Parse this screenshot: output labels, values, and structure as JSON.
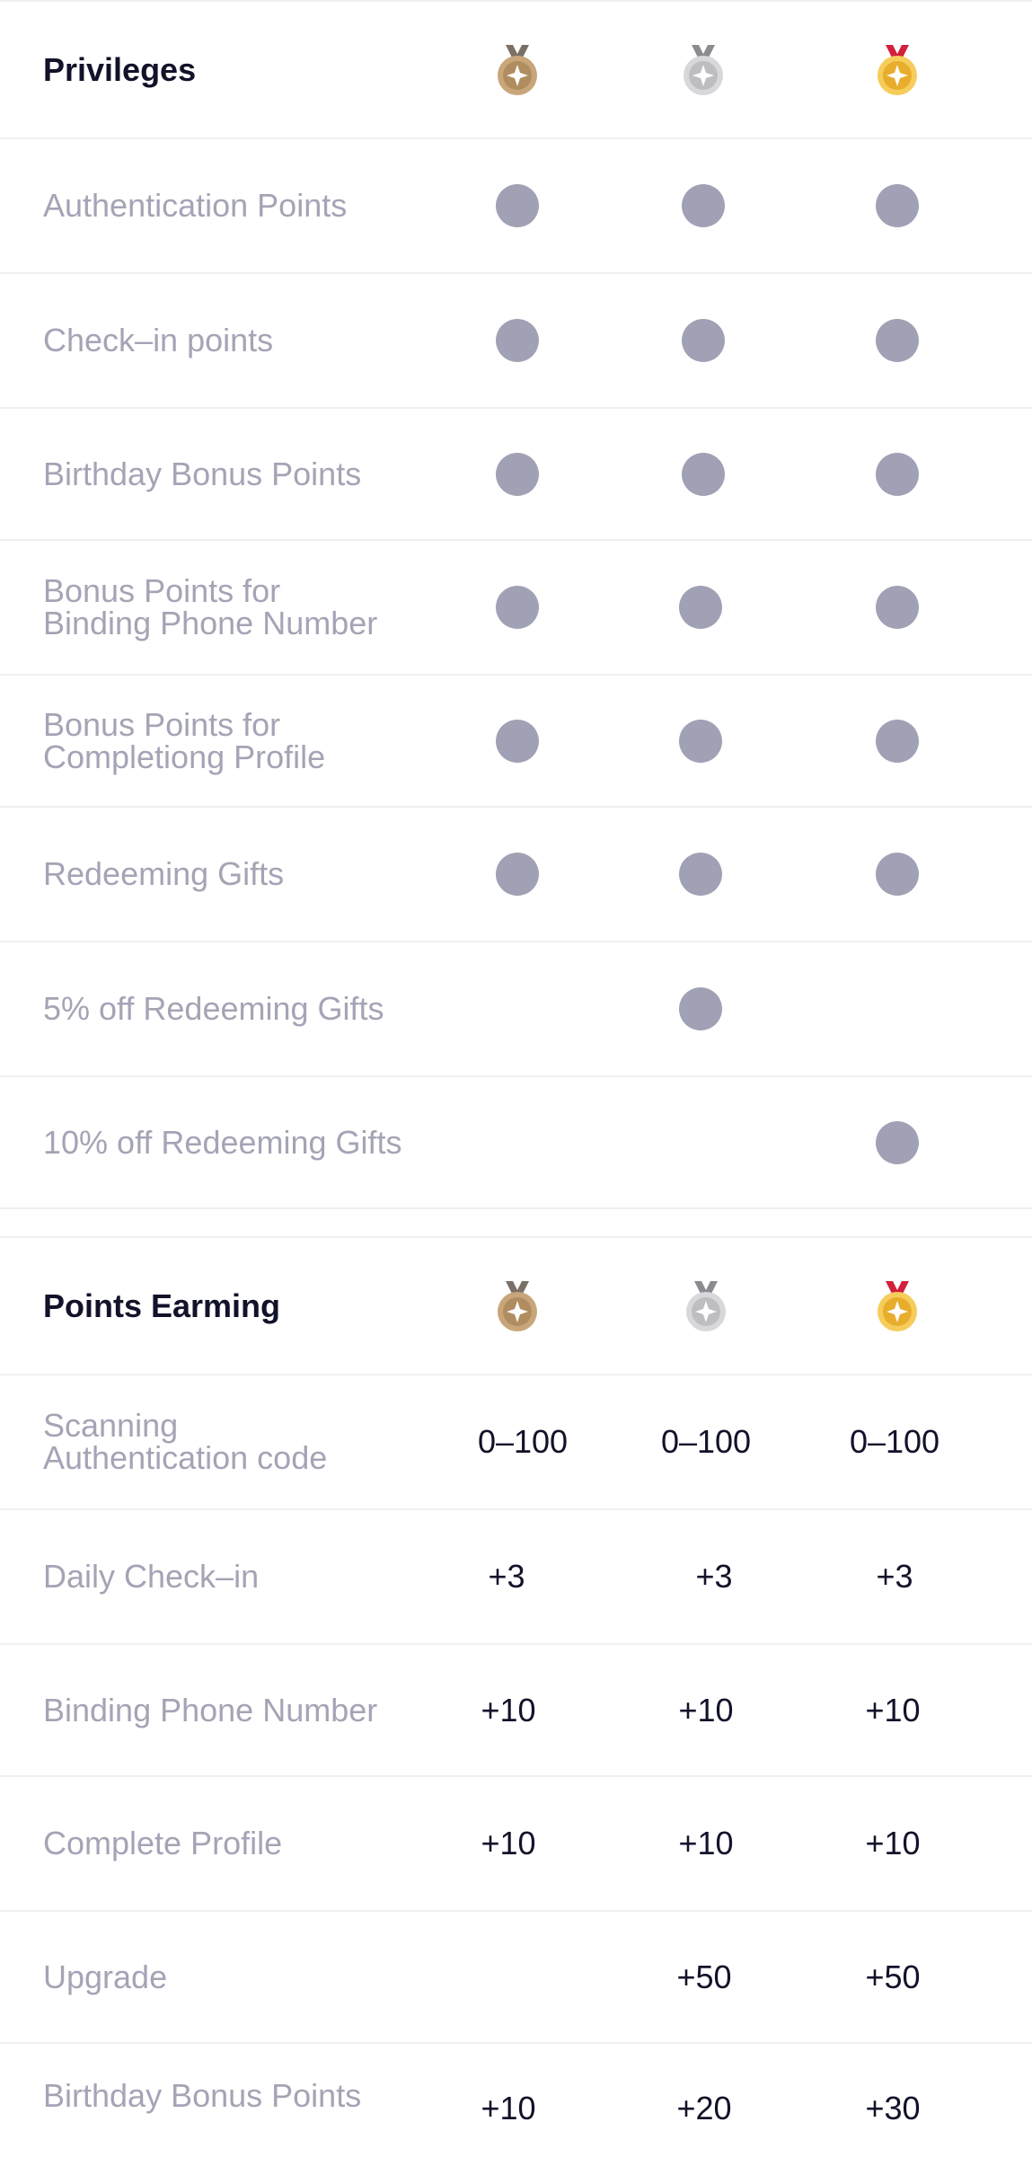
{
  "privileges": {
    "header": {
      "label": "Privileges",
      "tier_icons": [
        "bronze-medal-icon",
        "silver-medal-icon",
        "gold-medal-icon"
      ]
    },
    "rows": [
      {
        "label": "Authentication Points",
        "tiers": [
          true,
          true,
          true
        ]
      },
      {
        "label": "Check–in points",
        "tiers": [
          true,
          true,
          true
        ]
      },
      {
        "label": "Birthday Bonus Points",
        "tiers": [
          true,
          true,
          true
        ]
      },
      {
        "label": "Bonus Points for\nBinding Phone Number",
        "tiers": [
          true,
          true,
          true
        ]
      },
      {
        "label": "Bonus Points for\nCompletiong Profile",
        "tiers": [
          true,
          true,
          true
        ]
      },
      {
        "label": "Redeeming Gifts",
        "tiers": [
          true,
          true,
          true
        ]
      },
      {
        "label": "5% off Redeeming Gifts",
        "tiers": [
          false,
          true,
          false
        ]
      },
      {
        "label": "10% off Redeeming Gifts",
        "tiers": [
          false,
          false,
          true
        ]
      }
    ]
  },
  "points_earning": {
    "header": {
      "label": "Points Earming",
      "tier_icons": [
        "bronze-medal-icon",
        "silver-medal-icon",
        "gold-medal-icon"
      ]
    },
    "rows": [
      {
        "label": "Scanning\nAuthentication code",
        "values": [
          "0–100",
          "0–100",
          "0–100"
        ]
      },
      {
        "label": "Daily Check–in",
        "values": [
          "+3",
          "+3",
          "+3"
        ]
      },
      {
        "label": "Binding Phone Number",
        "values": [
          "+10",
          "+10",
          "+10"
        ]
      },
      {
        "label": "Complete Profile",
        "values": [
          "+10",
          "+10",
          "+10"
        ]
      },
      {
        "label": "Upgrade",
        "values": [
          "",
          "+50",
          "+50"
        ]
      },
      {
        "label": "Birthday Bonus Points",
        "values": [
          "+10",
          "+20",
          "+30"
        ]
      }
    ]
  },
  "colors": {
    "dot": "#a1a1b5",
    "label_text": "#a4a4b6",
    "value_text": "#12122a",
    "divider": "#efeff3",
    "bronze": "#c8a67a",
    "silver": "#d3d3d6",
    "gold": "#f2c24b"
  }
}
